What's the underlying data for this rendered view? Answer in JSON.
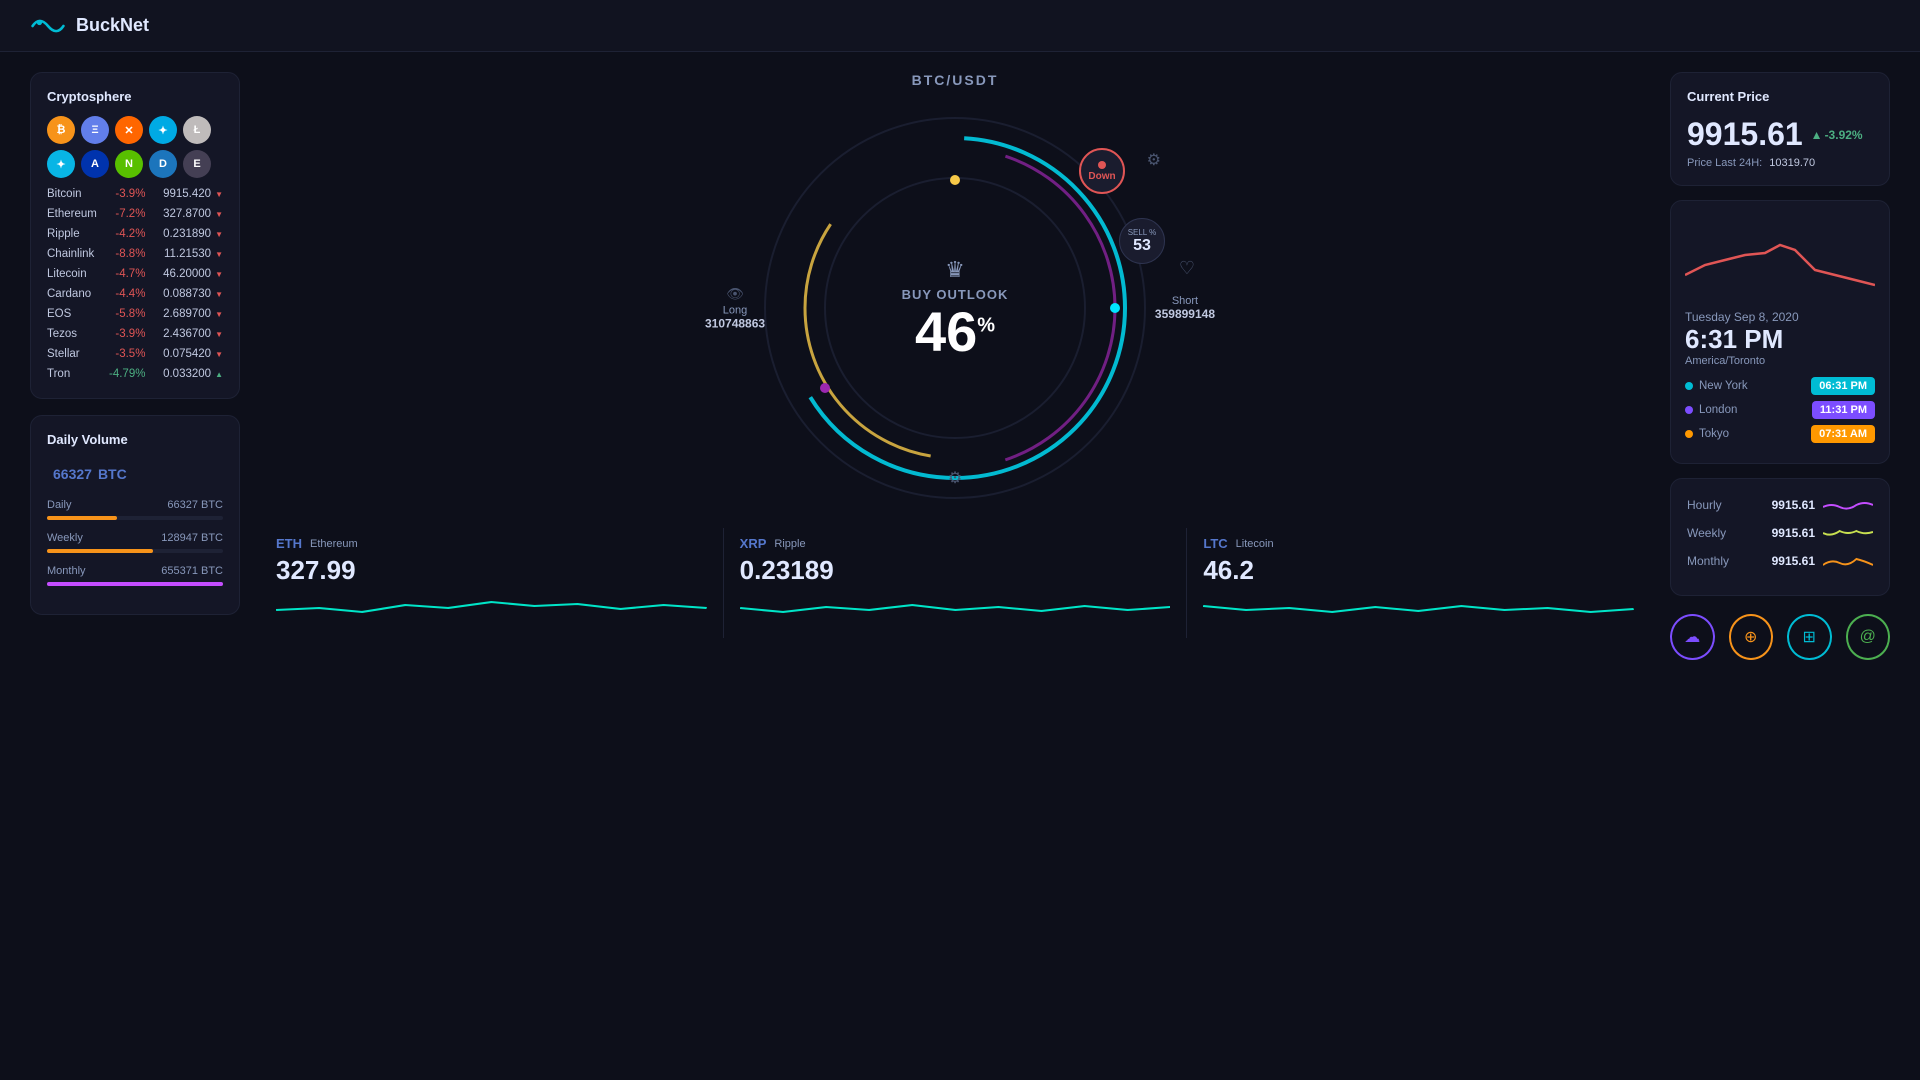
{
  "header": {
    "logo_text": "BuckNet"
  },
  "cryptosphere": {
    "title": "Cryptosphere",
    "icons": [
      {
        "id": "btc",
        "symbol": "B",
        "class": "ci-btc"
      },
      {
        "id": "eth",
        "symbol": "Ξ",
        "class": "ci-eth"
      },
      {
        "id": "xmr",
        "symbol": "✕",
        "class": "ci-xmr"
      },
      {
        "id": "xrp",
        "symbol": "✦",
        "class": "ci-xrp"
      },
      {
        "id": "ltc",
        "symbol": "Ł",
        "class": "ci-ltc"
      },
      {
        "id": "stellar",
        "symbol": "✦",
        "class": "ci-stellar"
      },
      {
        "id": "ada",
        "symbol": "A",
        "class": "ci-ada"
      },
      {
        "id": "neo",
        "symbol": "N",
        "class": "ci-neo"
      },
      {
        "id": "dash",
        "symbol": "D",
        "class": "ci-dash"
      },
      {
        "id": "eos",
        "symbol": "E",
        "class": "ci-eos"
      }
    ],
    "coins": [
      {
        "name": "Bitcoin",
        "change": "-3.9%",
        "change_dir": "down",
        "price": "9915.420"
      },
      {
        "name": "Ethereum",
        "change": "-7.2%",
        "change_dir": "down",
        "price": "327.8700"
      },
      {
        "name": "Ripple",
        "change": "-4.2%",
        "change_dir": "down",
        "price": "0.231890"
      },
      {
        "name": "Chainlink",
        "change": "-8.8%",
        "change_dir": "down",
        "price": "11.21530"
      },
      {
        "name": "Litecoin",
        "change": "-4.7%",
        "change_dir": "down",
        "price": "46.20000"
      },
      {
        "name": "Cardano",
        "change": "-4.4%",
        "change_dir": "down",
        "price": "0.088730"
      },
      {
        "name": "EOS",
        "change": "-5.8%",
        "change_dir": "down",
        "price": "2.689700"
      },
      {
        "name": "Tezos",
        "change": "-3.9%",
        "change_dir": "down",
        "price": "2.436700"
      },
      {
        "name": "Stellar",
        "change": "-3.5%",
        "change_dir": "down",
        "price": "0.075420"
      },
      {
        "name": "Tron",
        "change": "-4.79%",
        "change_dir": "up",
        "price": "0.033200"
      }
    ]
  },
  "daily_volume": {
    "title": "Daily Volume",
    "amount": "66327",
    "unit": "BTC",
    "rows": [
      {
        "label": "Daily",
        "value": "66327 BTC",
        "bar_pct": 40,
        "bar_class": "bar-daily"
      },
      {
        "label": "Weekly",
        "value": "128947 BTC",
        "bar_pct": 60,
        "bar_class": "bar-weekly"
      },
      {
        "label": "Monthly",
        "value": "655371 BTC",
        "bar_pct": 100,
        "bar_class": "bar-monthly"
      }
    ]
  },
  "gauge": {
    "pair": "BTC/USDT",
    "buy_outlook_label": "BUY OUTLOOK",
    "percent": "46",
    "percent_sup": "%",
    "long_label": "Long",
    "long_value": "310748863",
    "short_label": "Short",
    "short_value": "359899148",
    "down_label": "Down",
    "sell_label": "SELL %",
    "sell_value": "53"
  },
  "tickers": [
    {
      "symbol": "ETH",
      "name": "Ethereum",
      "price": "327.99"
    },
    {
      "symbol": "XRP",
      "name": "Ripple",
      "price": "0.23189"
    },
    {
      "symbol": "LTC",
      "name": "Litecoin",
      "price": "46.2"
    }
  ],
  "current_price": {
    "title": "Current Price",
    "value": "9915.61",
    "change": "-3.92%",
    "last24_label": "Price Last 24H:",
    "last24_value": "10319.70"
  },
  "clock": {
    "date": "Tuesday Sep 8, 2020",
    "time": "6:31 PM",
    "timezone": "America/Toronto",
    "cities": [
      {
        "name": "New York",
        "time": "06:31 PM",
        "badge_class": "badge-cyan",
        "dot_color": "#00bcd4"
      },
      {
        "name": "London",
        "time": "11:31 PM",
        "badge_class": "badge-purple",
        "dot_color": "#7c4dff"
      },
      {
        "name": "Tokyo",
        "time": "07:31 AM",
        "badge_class": "badge-orange",
        "dot_color": "#ff9800"
      }
    ]
  },
  "price_history": {
    "rows": [
      {
        "label": "Hourly",
        "value": "9915.61",
        "color": "#c44dff"
      },
      {
        "label": "Weekly",
        "value": "9915.61",
        "color": "#c8e050"
      },
      {
        "label": "Monthly",
        "value": "9915.61",
        "color": "#f7931a"
      }
    ]
  },
  "bottom_icons": [
    {
      "id": "cloud",
      "symbol": "☁",
      "class": "bic-purple"
    },
    {
      "id": "satellite",
      "symbol": "⊕",
      "class": "bic-yellow"
    },
    {
      "id": "server",
      "symbol": "⊞",
      "class": "bic-blue"
    },
    {
      "id": "at",
      "symbol": "@",
      "class": "bic-green"
    }
  ]
}
